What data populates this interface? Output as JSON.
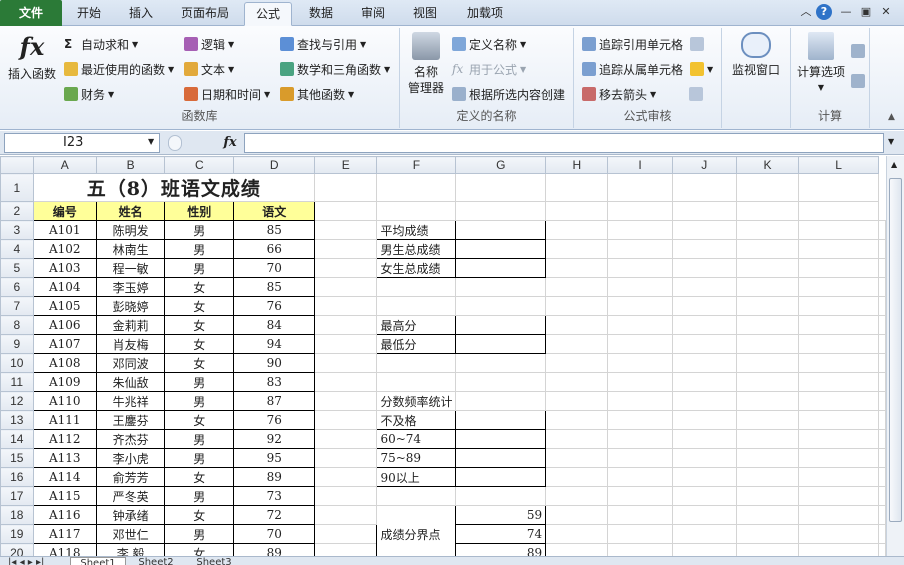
{
  "tabs": [
    "文件",
    "开始",
    "插入",
    "页面布局",
    "公式",
    "数据",
    "审阅",
    "视图",
    "加载项"
  ],
  "active_tab": "公式",
  "ribbon": {
    "insert_function": "插入函数",
    "autosum": "自动求和",
    "recent": "最近使用的函数",
    "finance": "财务",
    "logic": "逻辑",
    "text": "文本",
    "datetime": "日期和时间",
    "lookup": "查找与引用",
    "math": "数学和三角函数",
    "other": "其他函数",
    "group_library": "函数库",
    "name_manager_1": "名称",
    "name_manager_2": "管理器",
    "define_name": "定义名称",
    "use_in_formula": "用于公式",
    "create_from_selection": "根据所选内容创建",
    "group_names": "定义的名称",
    "trace_precedents": "追踪引用单元格",
    "trace_dependents": "追踪从属单元格",
    "remove_arrows": "移去箭头",
    "watch_window": "监视窗口",
    "group_audit": "公式审核",
    "calc_options": "计算选项",
    "group_calc": "计算"
  },
  "icons": [
    "fx-icon",
    "sigma-icon",
    "book-icon",
    "question-icon",
    "minimize-icon",
    "restore-icon",
    "close-icon",
    "dropdown-icon",
    "watch-window-icon",
    "calc-icon"
  ],
  "formula_bar": {
    "name_box": "I23",
    "fx": "fx",
    "value": ""
  },
  "columns": [
    "A",
    "B",
    "C",
    "D",
    "E",
    "F",
    "G",
    "H",
    "I",
    "J",
    "K",
    "L"
  ],
  "sheet": {
    "title": "五（8）班语文成绩",
    "headers": [
      "编号",
      "姓名",
      "性别",
      "语文"
    ],
    "rows": [
      {
        "id": "A101",
        "name": "陈明发",
        "gender": "男",
        "score": "85"
      },
      {
        "id": "A102",
        "name": "林南生",
        "gender": "男",
        "score": "66"
      },
      {
        "id": "A103",
        "name": "程一敏",
        "gender": "男",
        "score": "70"
      },
      {
        "id": "A104",
        "name": "李玉婷",
        "gender": "女",
        "score": "85"
      },
      {
        "id": "A105",
        "name": "彭晓婷",
        "gender": "女",
        "score": "76"
      },
      {
        "id": "A106",
        "name": "金莉莉",
        "gender": "女",
        "score": "84"
      },
      {
        "id": "A107",
        "name": "肖友梅",
        "gender": "女",
        "score": "94"
      },
      {
        "id": "A108",
        "name": "邓同波",
        "gender": "女",
        "score": "90"
      },
      {
        "id": "A109",
        "name": "朱仙敌",
        "gender": "男",
        "score": "83"
      },
      {
        "id": "A110",
        "name": "牛兆祥",
        "gender": "男",
        "score": "87"
      },
      {
        "id": "A111",
        "name": "王鏖芬",
        "gender": "女",
        "score": "76"
      },
      {
        "id": "A112",
        "name": "齐杰芬",
        "gender": "男",
        "score": "92"
      },
      {
        "id": "A113",
        "name": "李小虎",
        "gender": "男",
        "score": "95"
      },
      {
        "id": "A114",
        "name": "俞芳芳",
        "gender": "女",
        "score": "89"
      },
      {
        "id": "A115",
        "name": "严冬英",
        "gender": "男",
        "score": "73"
      },
      {
        "id": "A116",
        "name": "钟承绪",
        "gender": "女",
        "score": "72"
      },
      {
        "id": "A117",
        "name": "邓世仁",
        "gender": "男",
        "score": "70"
      },
      {
        "id": "A118",
        "name": "李 毅",
        "gender": "女",
        "score": "89"
      }
    ],
    "side": {
      "avg": "平均成绩",
      "male_total": "男生总成绩",
      "female_total": "女生总成绩",
      "max": "最高分",
      "min": "最低分",
      "freq_title": "分数频率统计",
      "fail": "不及格",
      "r60": "60~74",
      "r75": "75~89",
      "r90": "90以上",
      "cut_label": "成绩分界点",
      "cuts": [
        "59",
        "74",
        "89"
      ]
    }
  },
  "sheet_tabs": [
    "Sheet1",
    "Sheet2",
    "Sheet3"
  ]
}
